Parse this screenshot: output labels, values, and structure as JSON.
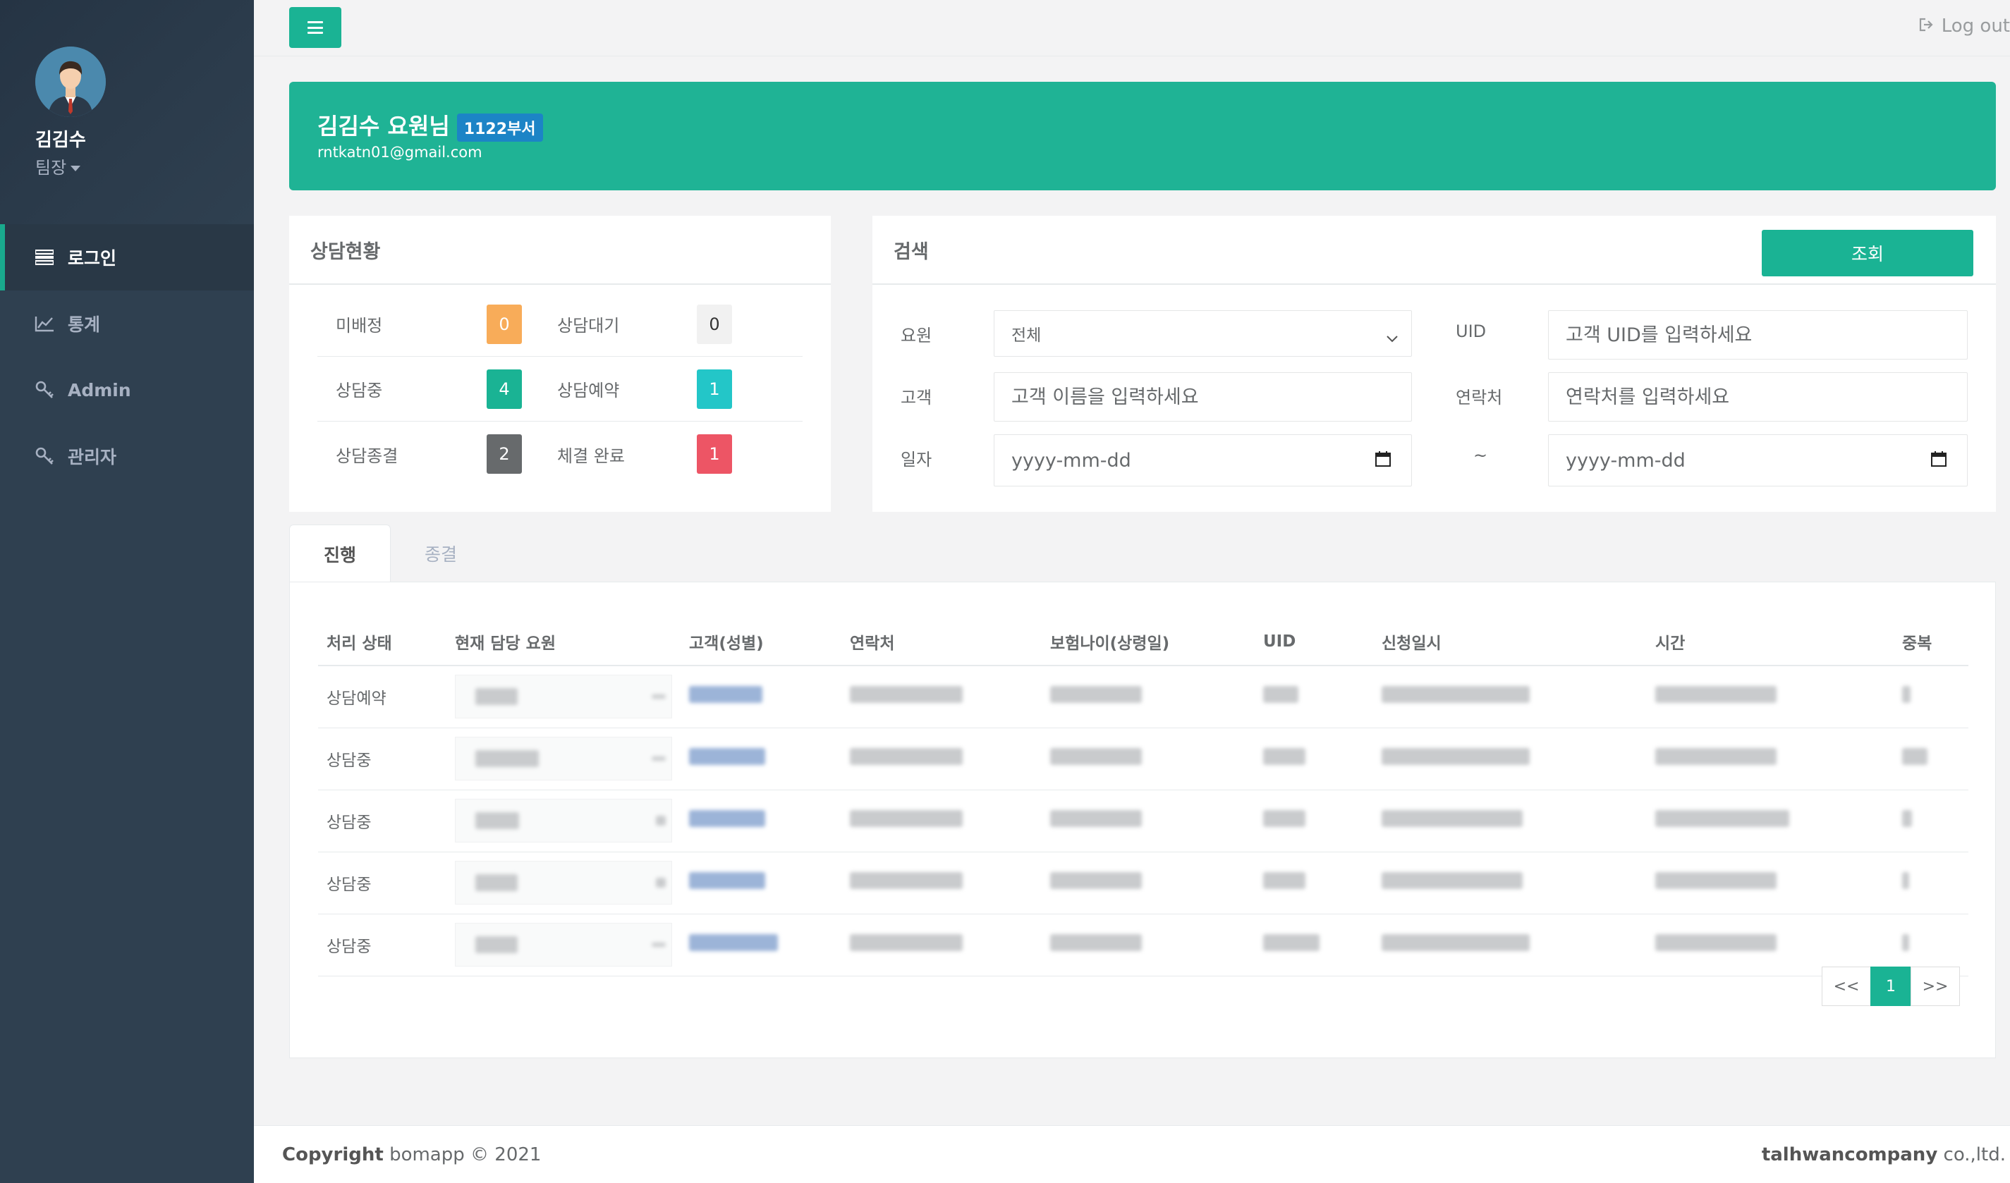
{
  "profile": {
    "name": "김김수",
    "role": "팀장"
  },
  "nav": {
    "items": [
      {
        "label": "로그인",
        "icon": "list-icon",
        "active": true
      },
      {
        "label": "통계",
        "icon": "line-chart-icon",
        "active": false
      },
      {
        "label": "Admin",
        "icon": "key-icon",
        "active": false
      },
      {
        "label": "관리자",
        "icon": "key-icon",
        "active": false
      }
    ]
  },
  "topbar": {
    "logout_label": "Log out"
  },
  "banner": {
    "name": "김김수 요원님",
    "dept": "1122부서",
    "email": "rntkatn01@gmail.com"
  },
  "status": {
    "title": "상담현황",
    "items": [
      {
        "label": "미배정",
        "count": "0",
        "color": "#f8ac59"
      },
      {
        "label": "상담대기",
        "count": "0",
        "color": "#f1f1f1"
      },
      {
        "label": "상담중",
        "count": "4",
        "color": "#1ab394"
      },
      {
        "label": "상담예약",
        "count": "1",
        "color": "#23c6c8"
      },
      {
        "label": "상담종결",
        "count": "2",
        "color": "#676a6c"
      },
      {
        "label": "체결 완료",
        "count": "1",
        "color": "#ed5565"
      }
    ]
  },
  "search": {
    "title": "검색",
    "button": "조회",
    "agent_label": "요원",
    "agent_value": "전체",
    "uid_label": "UID",
    "uid_placeholder": "고객 UID를 입력하세요",
    "customer_label": "고객",
    "customer_placeholder": "고객 이름을 입력하세요",
    "contact_label": "연락처",
    "contact_placeholder": "연락처를 입력하세요",
    "date_label": "일자",
    "date_from": "yyyy-mm-dd",
    "date_sep": "~",
    "date_to": "yyyy-mm-dd"
  },
  "tabs": [
    {
      "label": "진행",
      "active": true
    },
    {
      "label": "종결",
      "active": false
    }
  ],
  "table": {
    "headers": [
      "처리 상태",
      "현재 담당 요원",
      "고객(성별)",
      "연락처",
      "보험나이(상령일)",
      "UID",
      "신청일시",
      "시간",
      "중복"
    ],
    "rows": [
      {
        "status": "상담예약"
      },
      {
        "status": "상담중"
      },
      {
        "status": "상담중"
      },
      {
        "status": "상담중"
      },
      {
        "status": "상담중"
      }
    ]
  },
  "pagination": {
    "prev": "<<",
    "current": "1",
    "next": ">>"
  },
  "footer": {
    "copyright_bold": "Copyright",
    "copyright_rest": "bomapp © 2021",
    "company_bold": "talhwancompany",
    "company_rest": "co.,ltd."
  },
  "colors": {
    "accent": "#1ab394",
    "sidebar": "#2f4050"
  }
}
